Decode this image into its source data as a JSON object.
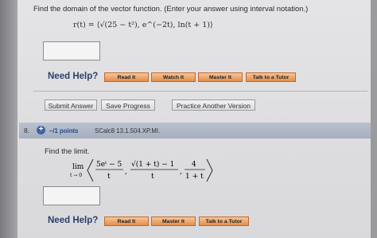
{
  "q7": {
    "prompt": "Find the domain of the vector function. (Enter your answer using interval notation.)",
    "formula": "r(t) = ⟨√(25 − t²), e^(−2t), ln(t + 1)⟩",
    "answer_value": "",
    "need_help_label": "Need Help?",
    "help_buttons": [
      "Read It",
      "Watch It",
      "Master It",
      "Talk to a Tutor"
    ],
    "actions": [
      "Submit Answer",
      "Save Progress",
      "Practice Another Version"
    ]
  },
  "q8": {
    "number": "8.",
    "points_label": "–/1 points",
    "source": "SCalc8 13.1.504.XP.MI.",
    "prompt": "Find the limit.",
    "lim_word": "lim",
    "lim_sub": "t → 0",
    "term1_num": "5eᵗ − 5",
    "term1_den": "t",
    "term2_num": "√(1 + t) − 1",
    "term2_den": "t",
    "term3_num": "4",
    "term3_den": "1 + t",
    "answer_value": "",
    "need_help_label": "Need Help?",
    "help_buttons": [
      "Read It",
      "Master It",
      "Talk to a Tutor"
    ]
  },
  "colors": {
    "help_button": "#e48d49",
    "header_band": "#a6afbf",
    "need_help": "#2a3f6a",
    "points": "#2a4a8a"
  },
  "icons": {
    "expand": "plus-circle-icon"
  }
}
